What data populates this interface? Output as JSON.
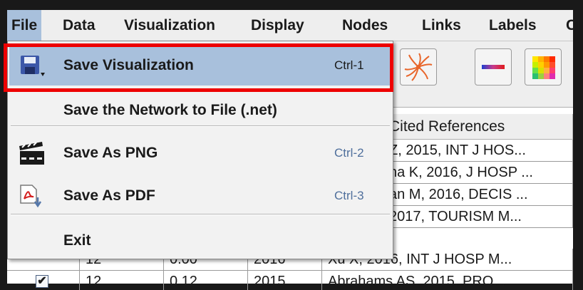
{
  "menubar": {
    "items": [
      {
        "label": "File"
      },
      {
        "label": "Data"
      },
      {
        "label": "Visualization"
      },
      {
        "label": "Display"
      },
      {
        "label": "Nodes"
      },
      {
        "label": "Links"
      },
      {
        "label": "Labels"
      },
      {
        "label": "Cl"
      }
    ]
  },
  "file_menu": {
    "items": [
      {
        "label": "Save Visualization",
        "shortcut": "Ctrl-1",
        "icon": "save-disk-icon"
      },
      {
        "label": "Save the Network to File (.net)",
        "shortcut": "",
        "icon": ""
      },
      {
        "label": "Save As PNG",
        "shortcut": "Ctrl-2",
        "icon": "clapperboard-icon"
      },
      {
        "label": "Save As PDF",
        "shortcut": "Ctrl-3",
        "icon": "pdf-export-icon"
      },
      {
        "label": "Exit",
        "shortcut": "",
        "icon": ""
      }
    ]
  },
  "toolbar": {
    "icons": [
      "starburst-layout-icon",
      "color-gradient-icon",
      "color-grid-icon"
    ]
  },
  "table": {
    "header_visible": "Cited References",
    "rows": [
      {
        "ref": "Z, 2015, INT J HOS..."
      },
      {
        "ref": "na K, 2016, J HOSP ..."
      },
      {
        "ref": "an M, 2016, DECIS ..."
      },
      {
        "ref": "2017, TOURISM M..."
      },
      {
        "c1": "12",
        "c2": "0.00",
        "c3": "2016",
        "ref": "Xu X, 2016, INT J HOSP M..."
      },
      {
        "c1": "12",
        "c2": "0.12",
        "c3": "2015",
        "ref": "Abrahams AS, 2015, PRO..."
      }
    ]
  },
  "colors": {
    "highlight": "#a8c0dc",
    "callout": "#ee0000",
    "shortcut_text": "#4f6f9c"
  }
}
